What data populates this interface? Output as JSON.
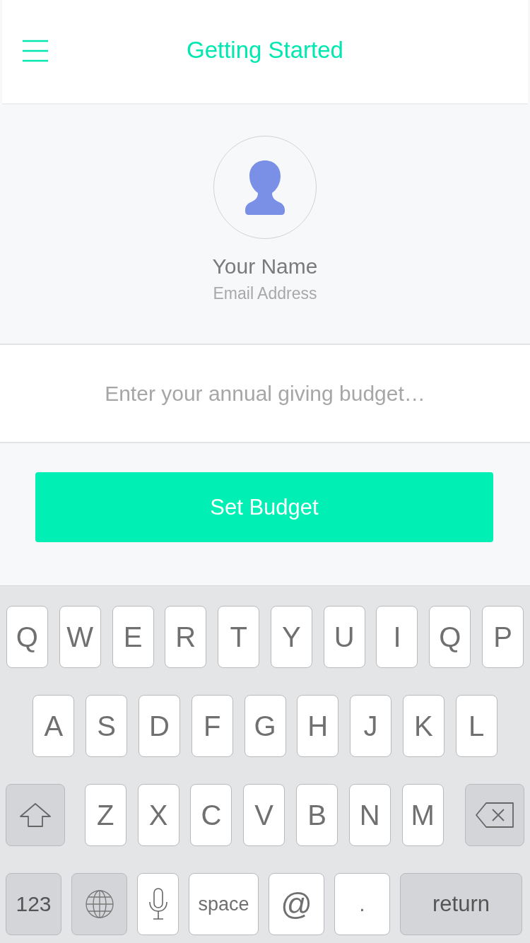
{
  "header": {
    "title": "Getting Started"
  },
  "profile": {
    "name": "Your Name",
    "email": "Email Address"
  },
  "budget_field": {
    "placeholder": "Enter your annual giving budget…"
  },
  "set_budget_button": {
    "label": "Set Budget"
  },
  "keyboard": {
    "top_row": [
      {
        "kind": "letter",
        "label": "Q"
      },
      {
        "kind": "letter",
        "label": "W"
      },
      {
        "kind": "letter",
        "label": "E"
      },
      {
        "kind": "letter",
        "label": "R"
      },
      {
        "kind": "letter",
        "label": "T"
      },
      {
        "kind": "letter",
        "label": "Y"
      },
      {
        "kind": "letter",
        "label": "U"
      },
      {
        "kind": "letter",
        "label": "I"
      },
      {
        "kind": "letter",
        "label": "Q"
      },
      {
        "kind": "letter",
        "label": "P"
      }
    ],
    "middle_row": [
      {
        "kind": "letter",
        "label": "A"
      },
      {
        "kind": "letter",
        "label": "S"
      },
      {
        "kind": "letter",
        "label": "D"
      },
      {
        "kind": "letter",
        "label": "F"
      },
      {
        "kind": "letter",
        "label": "G"
      },
      {
        "kind": "letter",
        "label": "H"
      },
      {
        "kind": "letter",
        "label": "J"
      },
      {
        "kind": "letter",
        "label": "K"
      },
      {
        "kind": "letter",
        "label": "L"
      }
    ],
    "lower_row": [
      {
        "kind": "shift"
      },
      {
        "kind": "letter",
        "label": "Z"
      },
      {
        "kind": "letter",
        "label": "X"
      },
      {
        "kind": "letter",
        "label": "C"
      },
      {
        "kind": "letter",
        "label": "V"
      },
      {
        "kind": "letter",
        "label": "B"
      },
      {
        "kind": "letter",
        "label": "N"
      },
      {
        "kind": "letter",
        "label": "M"
      },
      {
        "kind": "delete"
      }
    ],
    "bottom_row": [
      {
        "kind": "numbers",
        "label": "123"
      },
      {
        "kind": "globe"
      },
      {
        "kind": "mic"
      },
      {
        "kind": "space",
        "label": "space"
      },
      {
        "kind": "at",
        "label": "@"
      },
      {
        "kind": "dot",
        "label": "."
      },
      {
        "kind": "return",
        "label": "return"
      }
    ]
  }
}
